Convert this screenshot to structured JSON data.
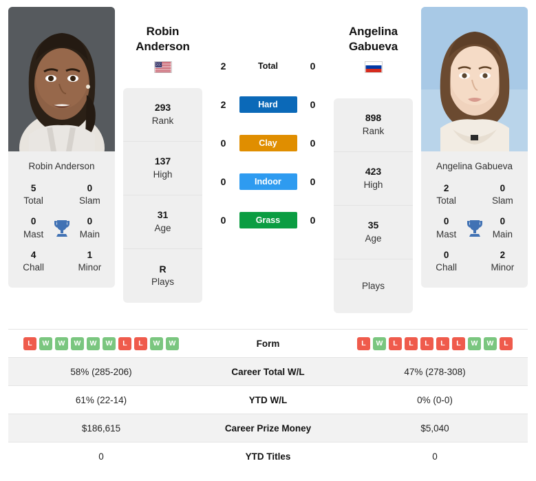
{
  "players": {
    "left": {
      "name_line1": "Robin",
      "name_line2": "Anderson",
      "full_name": "Robin Anderson",
      "caption": "Robin Anderson",
      "flag": "us-flag-icon",
      "rank": "293",
      "rank_label": "Rank",
      "high": "137",
      "high_label": "High",
      "age": "31",
      "age_label": "Age",
      "plays": "R",
      "plays_label": "Plays",
      "titles": {
        "total": "5",
        "total_label": "Total",
        "slam": "0",
        "slam_label": "Slam",
        "mast": "0",
        "mast_label": "Mast",
        "main": "0",
        "main_label": "Main",
        "chall": "4",
        "chall_label": "Chall",
        "minor": "1",
        "minor_label": "Minor"
      },
      "form": [
        "L",
        "W",
        "W",
        "W",
        "W",
        "W",
        "L",
        "L",
        "W",
        "W"
      ],
      "career_wl": "58% (285-206)",
      "ytd_wl": "61% (22-14)",
      "career_prize": "$186,615",
      "ytd_titles": "0"
    },
    "right": {
      "name_line1": "Angelina",
      "name_line2": "Gabueva",
      "full_name": "Angelina Gabueva",
      "caption": "Angelina Gabueva",
      "flag": "ru-flag-icon",
      "rank": "898",
      "rank_label": "Rank",
      "high": "423",
      "high_label": "High",
      "age": "35",
      "age_label": "Age",
      "plays": "",
      "plays_label": "Plays",
      "titles": {
        "total": "2",
        "total_label": "Total",
        "slam": "0",
        "slam_label": "Slam",
        "mast": "0",
        "mast_label": "Mast",
        "main": "0",
        "main_label": "Main",
        "chall": "0",
        "chall_label": "Chall",
        "minor": "2",
        "minor_label": "Minor"
      },
      "form": [
        "L",
        "W",
        "L",
        "L",
        "L",
        "L",
        "L",
        "W",
        "W",
        "L"
      ],
      "career_wl": "47% (278-308)",
      "ytd_wl": "0% (0-0)",
      "career_prize": "$5,040",
      "ytd_titles": "0"
    }
  },
  "h2h": {
    "rows": [
      {
        "left": "2",
        "label": "Total",
        "right": "0",
        "type": "plain",
        "color": ""
      },
      {
        "left": "2",
        "label": "Hard",
        "right": "0",
        "type": "badge",
        "color": "#0b69b8"
      },
      {
        "left": "0",
        "label": "Clay",
        "right": "0",
        "type": "badge",
        "color": "#e08e00"
      },
      {
        "left": "0",
        "label": "Indoor",
        "right": "0",
        "type": "badge",
        "color": "#2e9bf0"
      },
      {
        "left": "0",
        "label": "Grass",
        "right": "0",
        "type": "badge",
        "color": "#0b9d42"
      }
    ]
  },
  "table": {
    "rows": [
      {
        "label": "Form",
        "type": "form",
        "left": "",
        "right": ""
      },
      {
        "label": "Career Total W/L",
        "type": "text",
        "left": "58% (285-206)",
        "right": "47% (278-308)"
      },
      {
        "label": "YTD W/L",
        "type": "text",
        "left": "61% (22-14)",
        "right": "0% (0-0)"
      },
      {
        "label": "Career Prize Money",
        "type": "text",
        "left": "$186,615",
        "right": "$5,040"
      },
      {
        "label": "YTD Titles",
        "type": "text",
        "left": "0",
        "right": "0"
      }
    ]
  },
  "colors": {
    "win": "#7ac67f",
    "loss": "#ef5b4c",
    "trophy": "#4172b4",
    "card_bg": "#efefef",
    "row_alt": "#f2f2f2"
  }
}
